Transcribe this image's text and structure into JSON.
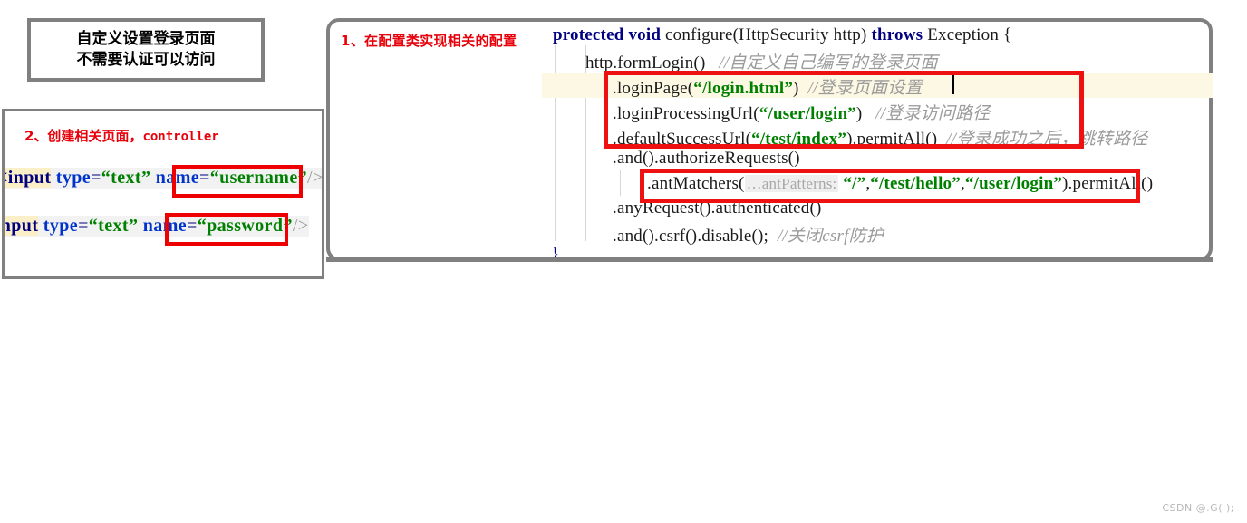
{
  "note_box": {
    "line1": "自定义设置登录页面",
    "line2": "不需要认证可以访问"
  },
  "left_panel": {
    "title_prefix": "2、创建相关页面，",
    "title_mono": "controller",
    "code_lines": [
      {
        "id": "username",
        "tag": "<input",
        "attr1": "type",
        "eq1": "=",
        "val1": "“text”",
        "attr2": "name",
        "eq2": "=",
        "val2": "“username”",
        "close": "/>"
      },
      {
        "id": "password",
        "tag": "<input",
        "attr1": "type",
        "eq1": "=",
        "val1": "“text”",
        "attr2": "name",
        "eq2": "=",
        "val2": "“password”",
        "close": "/>"
      }
    ]
  },
  "code_panel": {
    "step_label": "1、在配置类实现相关的配置",
    "rows": {
      "signature": {
        "kw1": "protected",
        "kw2": "void",
        "name": " configure",
        "params": "(HttpSecurity http) ",
        "kw3": "throws",
        "exception": " Exception {"
      },
      "formlogin": {
        "code": "http.formLogin()",
        "comment": "//自定义自己编写的登录页面"
      },
      "loginpage": {
        "method": ".loginPage(",
        "arg": "“/login.html”",
        "tail": ")",
        "comment": "//登录页面设置"
      },
      "processurl": {
        "method": ".loginProcessingUrl(",
        "arg": "“/user/login”",
        "tail": ")",
        "comment": "//登录访问路径"
      },
      "successurl": {
        "method": ".defaultSuccessUrl(",
        "arg": "“/test/index”",
        "tail": ").permitAll()",
        "comment": "//登录成功之后，跳转路径"
      },
      "andauth": {
        "code": ".and().authorizeRequests()"
      },
      "antmatchers": {
        "method": ".antMatchers(",
        "hint": "…antPatterns:",
        "arg1": "“/”",
        "sep1": ",",
        "arg2": "“/test/hello”",
        "sep2": ",",
        "arg3": "“/user/login”",
        "tail": ").permitAll()"
      },
      "anyrequest": {
        "code": ".anyRequest().authenticated()"
      },
      "csrf": {
        "code": ".and().csrf().disable();",
        "comment": "//关闭csrf防护"
      },
      "closebrace": {
        "code": "}"
      }
    }
  },
  "watermark": "CSDN @.G( );",
  "colors": {
    "red_annotation": "#e8000a",
    "red_box": "#ee1111",
    "panel_border": "#808080",
    "keyword": "#000080",
    "string": "#008000",
    "comment": "#9b9b9b",
    "line_highlight": "#fdf8e3"
  }
}
